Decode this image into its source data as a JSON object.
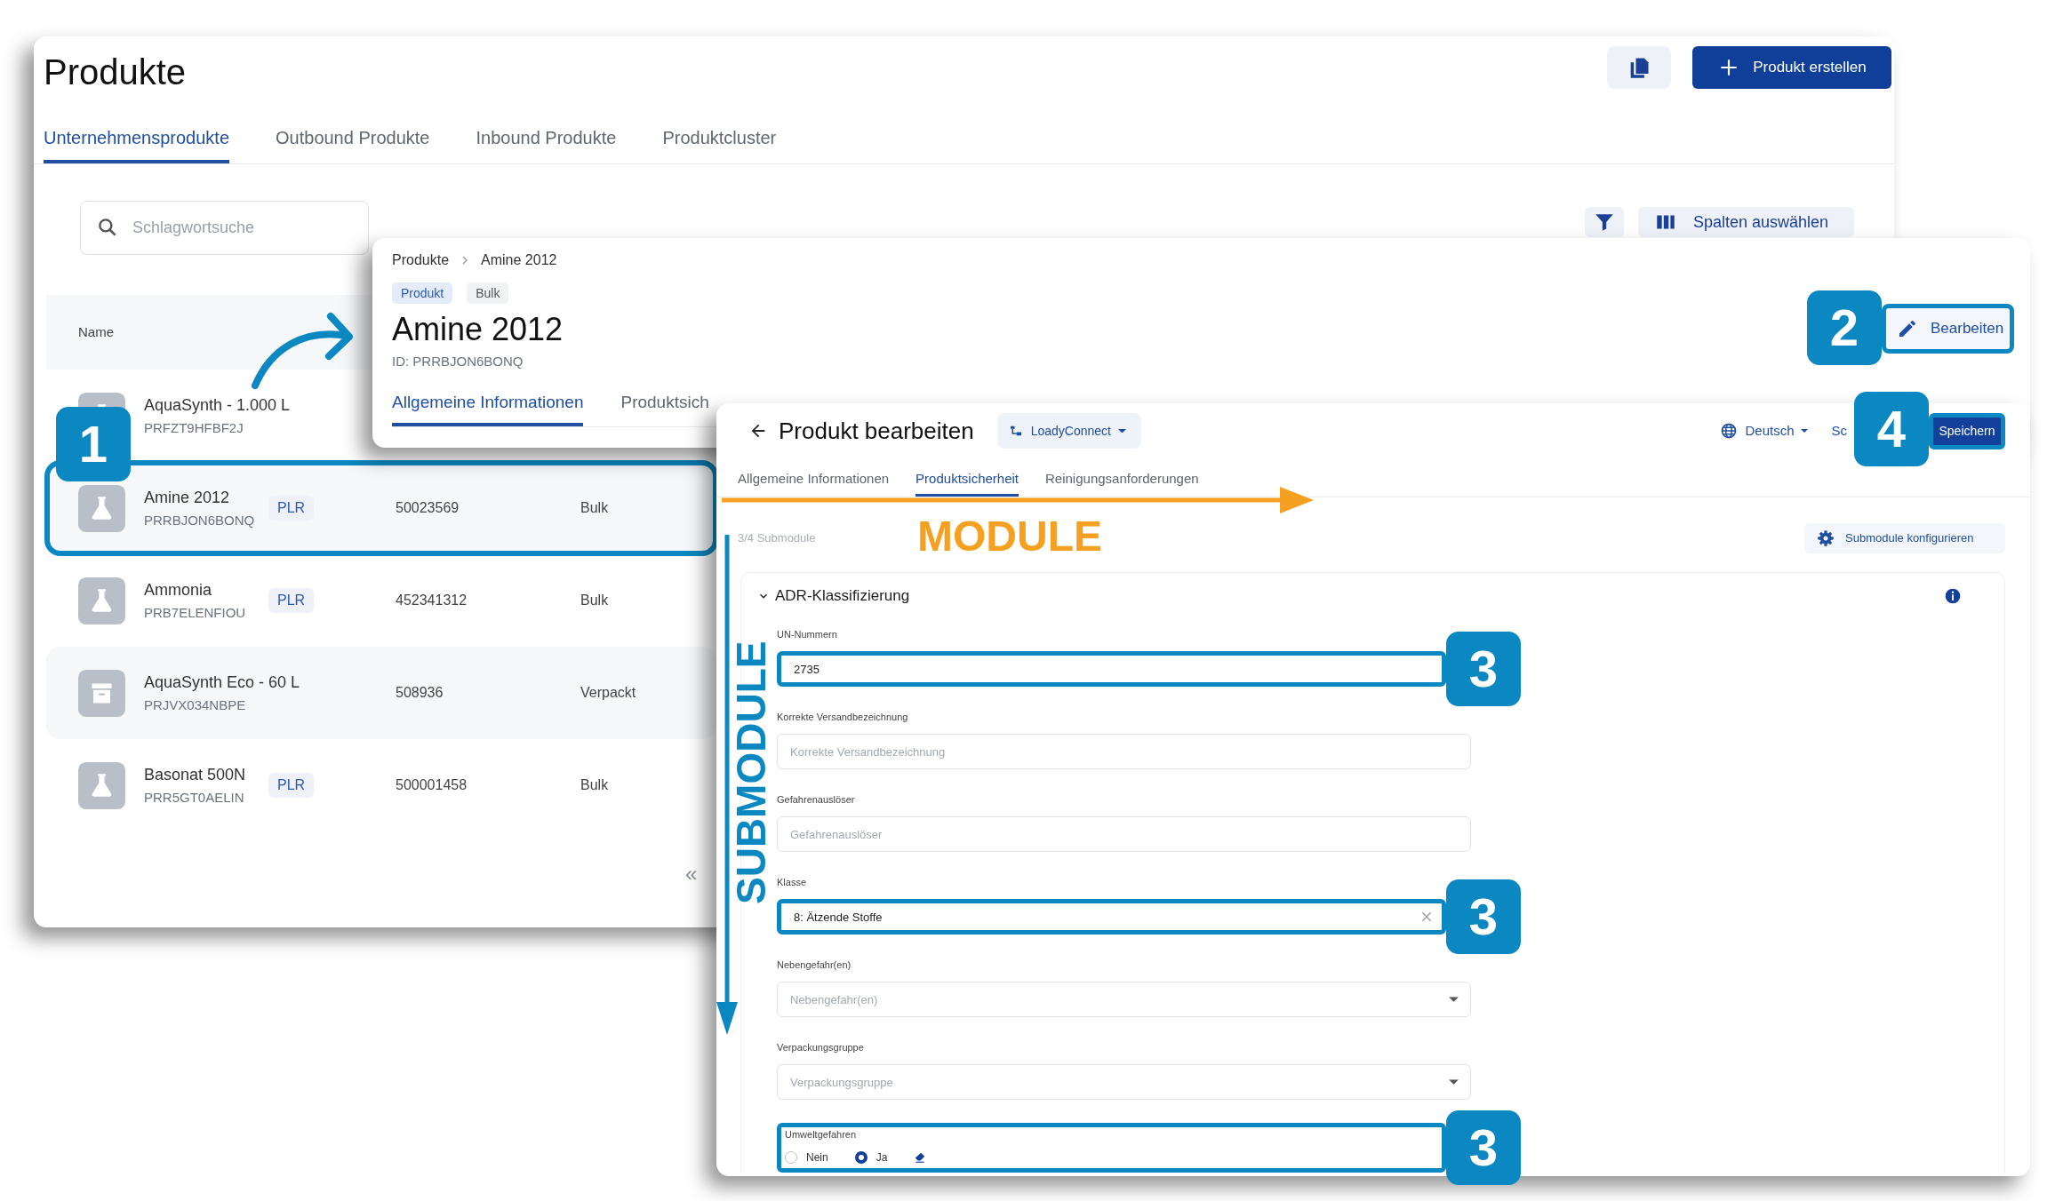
{
  "products_window": {
    "title": "Produkte",
    "create_button": "Produkt erstellen",
    "tabs": [
      {
        "label": "Unternehmensprodukte",
        "selected": true
      },
      {
        "label": "Outbound Produkte",
        "selected": false
      },
      {
        "label": "Inbound Produkte",
        "selected": false
      },
      {
        "label": "Produktcluster",
        "selected": false
      }
    ],
    "search": {
      "placeholder": "Schlagwortsuche"
    },
    "columns_button": "Spalten auswählen",
    "table": {
      "columns": [
        "Name"
      ],
      "rows": [
        {
          "name": "AquaSynth - 1.000 L",
          "code": "PRFZT9HFBF2J",
          "kind": "bulk",
          "highlighted": false
        },
        {
          "name": "Amine 2012",
          "code": "PRRBJON6BONQ",
          "badge": "PLR",
          "number": "50023569",
          "type": "Bulk",
          "kind": "bulk",
          "highlighted": true,
          "callout": "1"
        },
        {
          "name": "Ammonia",
          "code": "PRB7ELENFIOU",
          "badge": "PLR",
          "number": "452341312",
          "type": "Bulk",
          "kind": "bulk",
          "highlighted": false
        },
        {
          "name": "AquaSynth Eco - 60 L",
          "code": "PRJVX034NBPE",
          "number": "508936",
          "type": "Verpackt",
          "kind": "packaged",
          "highlighted": false
        },
        {
          "name": "Basonat 500N",
          "code": "PRR5GT0AELIN",
          "badge": "PLR",
          "number": "500001458",
          "type": "Bulk",
          "kind": "bulk",
          "highlighted": false
        }
      ]
    },
    "pager": "«"
  },
  "detail_window": {
    "breadcrumb": [
      "Produkte",
      "Amine 2012"
    ],
    "badges": [
      {
        "label": "Produkt",
        "kind": "primary"
      },
      {
        "label": "Bulk",
        "kind": "neutral"
      }
    ],
    "title": "Amine 2012",
    "id": "ID: PRRBJON6BONQ",
    "tabs": [
      {
        "label": "Allgemeine Informationen",
        "selected": true
      },
      {
        "label": "Produktsich",
        "selected": false
      }
    ],
    "edit_button": {
      "label": "Bearbeiten",
      "highlighted": true,
      "callout": "2"
    }
  },
  "edit_window": {
    "title": "Produkt bearbeiten",
    "company": "LoadyConnect",
    "language": "Deutsch",
    "cancel": "Sc",
    "save_button": {
      "label": "Speichern",
      "highlighted": true,
      "callout": "4"
    },
    "tabs": [
      {
        "label": "Allgemeine Informationen",
        "selected": false
      },
      {
        "label": "Produktsicherheit",
        "selected": true
      },
      {
        "label": "Reinigungsanforderungen",
        "selected": false
      }
    ],
    "submodule_count": "3/4 Submodule",
    "configure_button": "Submodule konfigurieren",
    "section": {
      "title": "ADR-Klassifizierung",
      "expanded": true,
      "fields": [
        {
          "kind": "text",
          "label": "UN-Nummern",
          "value": "2735",
          "highlighted": true,
          "callout": "3"
        },
        {
          "kind": "text",
          "label": "Korrekte Versandbezeichnung",
          "placeholder": "Korrekte Versandbezeichnung",
          "highlighted": false
        },
        {
          "kind": "text",
          "label": "Gefahrenauslöser",
          "placeholder": "Gefahrenauslöser",
          "highlighted": false
        },
        {
          "kind": "select",
          "label": "Klasse",
          "value": "8: Ätzende Stoffe",
          "clearable": true,
          "highlighted": true,
          "callout": "3"
        },
        {
          "kind": "select",
          "label": "Nebengefahr(en)",
          "placeholder": "Nebengefahr(en)",
          "clearable": false,
          "highlighted": false
        },
        {
          "kind": "select",
          "label": "Verpackungsgruppe",
          "placeholder": "Verpackungsgruppe",
          "clearable": false,
          "highlighted": false
        },
        {
          "kind": "radio",
          "label": "Umweltgefahren",
          "options": [
            {
              "label": "Nein",
              "selected": false
            },
            {
              "label": "Ja",
              "selected": true
            }
          ],
          "highlighted": true,
          "callout": "3"
        }
      ]
    }
  },
  "annotations": {
    "module_label": "MODULE",
    "submodule_label": "SUBMODULE"
  }
}
